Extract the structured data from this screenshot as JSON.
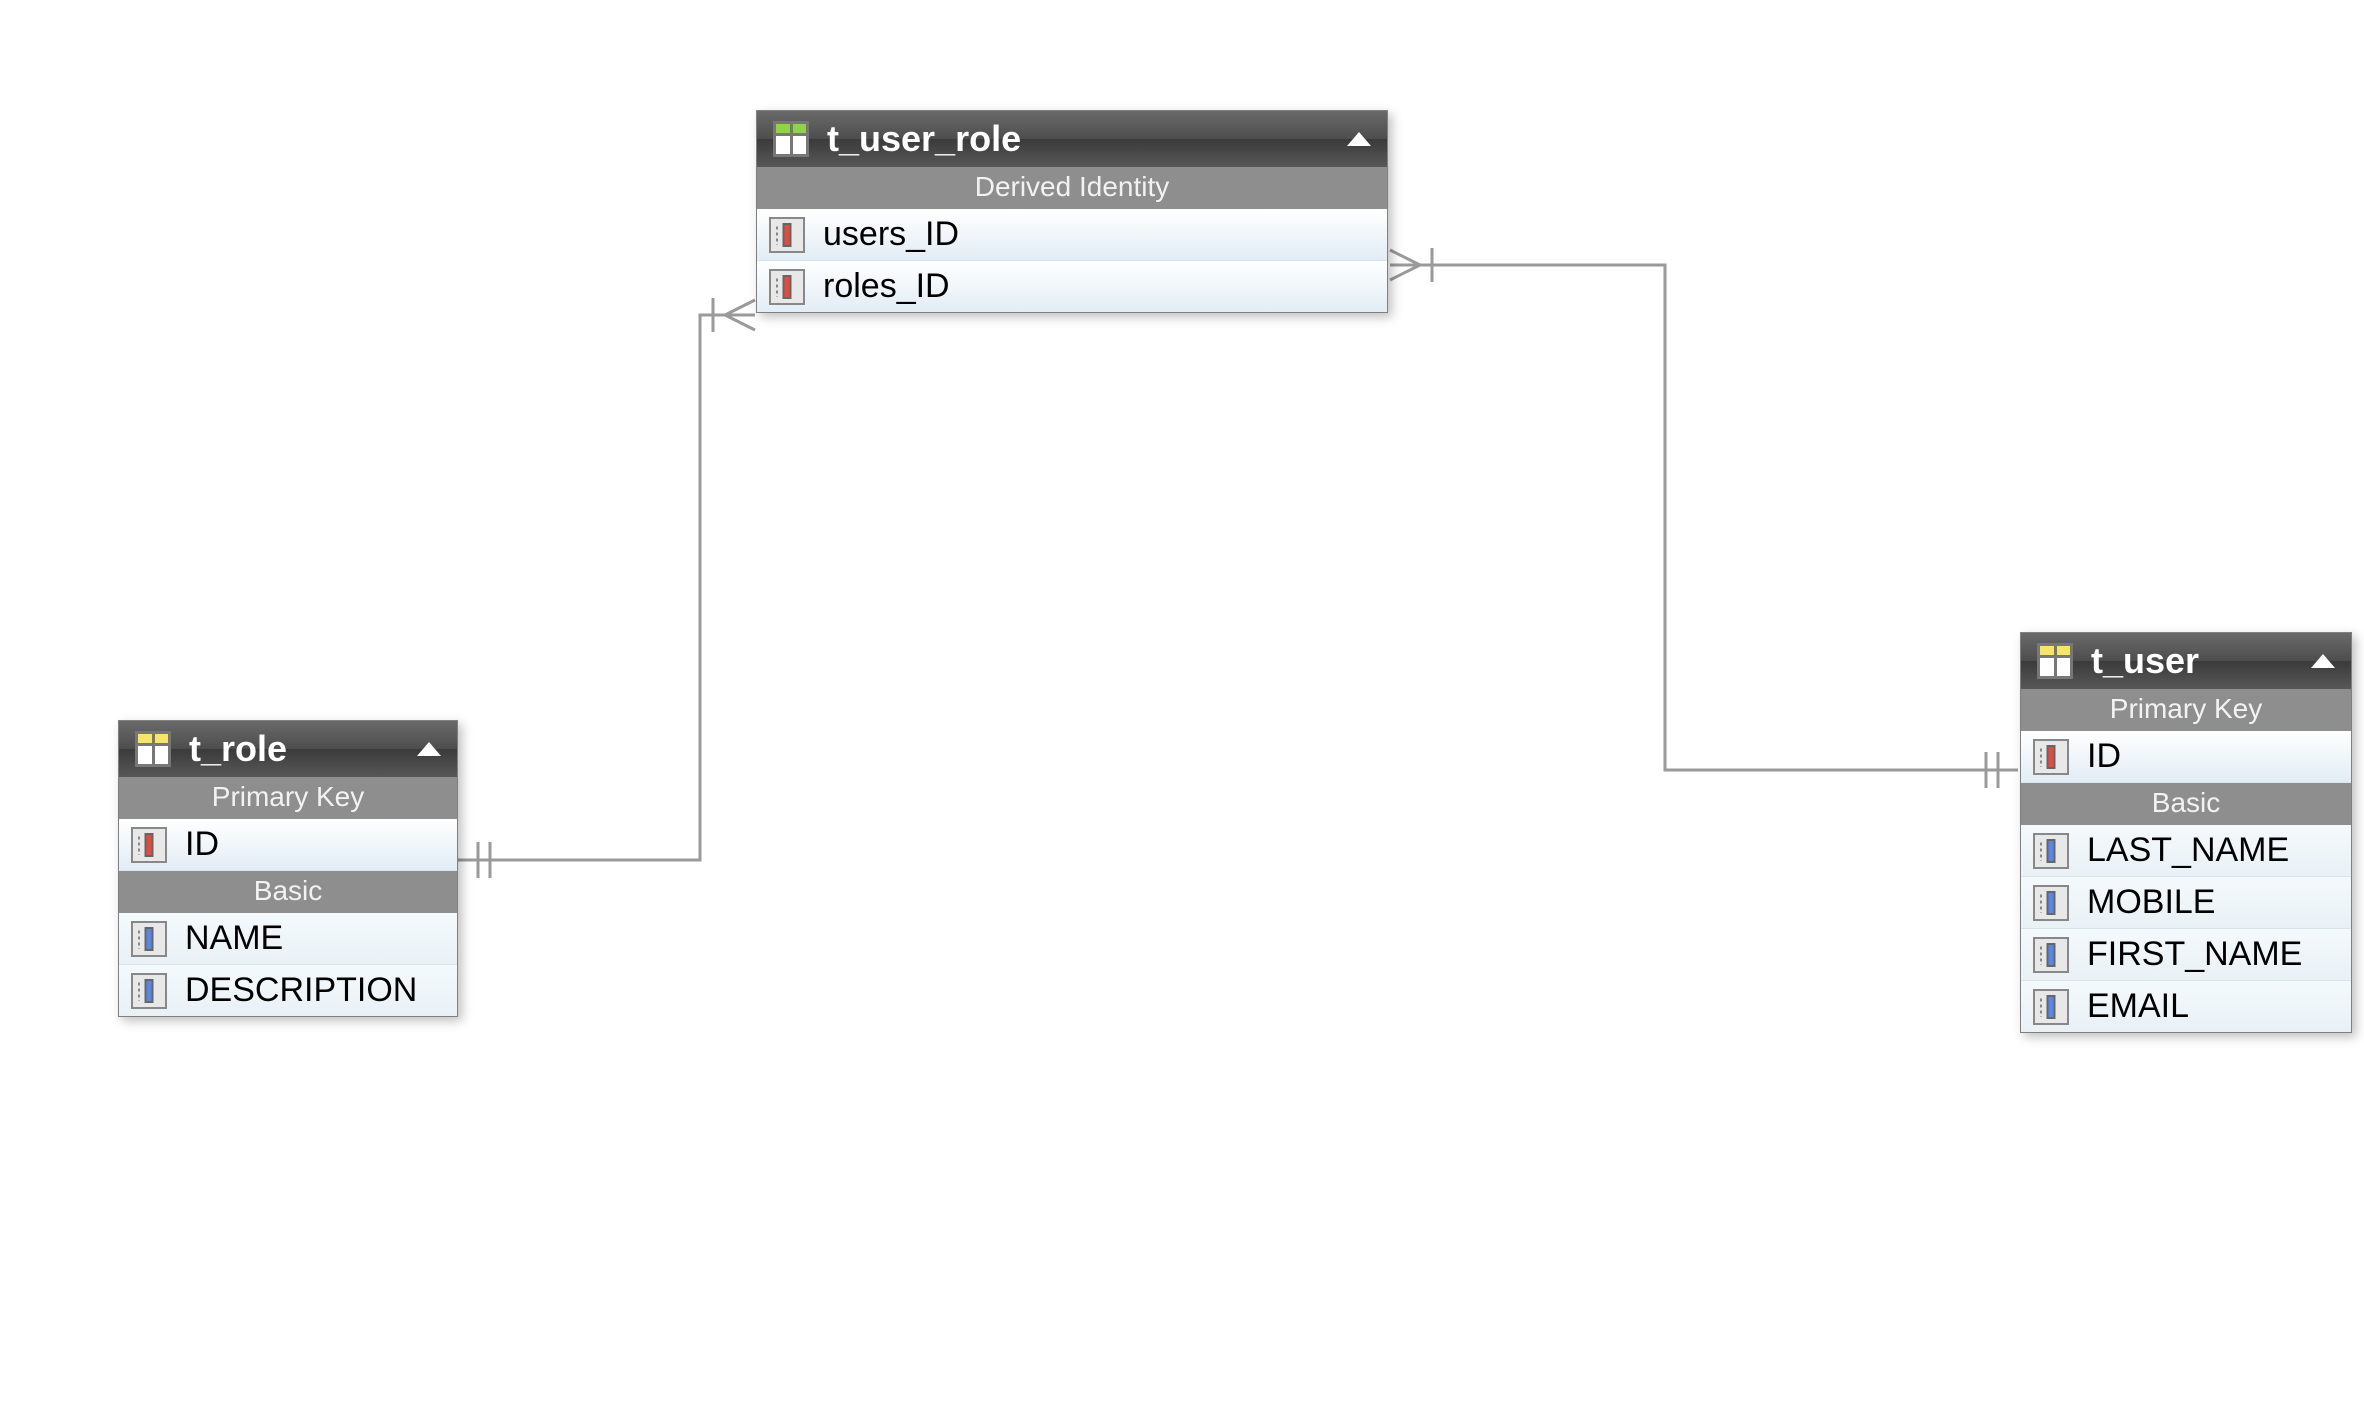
{
  "entities": {
    "t_user_role": {
      "title": "t_user_role",
      "section_derived": "Derived Identity",
      "cols": {
        "users_id": "users_ID",
        "roles_id": "roles_ID"
      }
    },
    "t_role": {
      "title": "t_role",
      "section_pk": "Primary Key",
      "section_basic": "Basic",
      "cols": {
        "id": "ID",
        "name": "NAME",
        "description": "DESCRIPTION"
      }
    },
    "t_user": {
      "title": "t_user",
      "section_pk": "Primary Key",
      "section_basic": "Basic",
      "cols": {
        "id": "ID",
        "last_name": "LAST_NAME",
        "mobile": "MOBILE",
        "first_name": "FIRST_NAME",
        "email": "EMAIL"
      }
    }
  }
}
